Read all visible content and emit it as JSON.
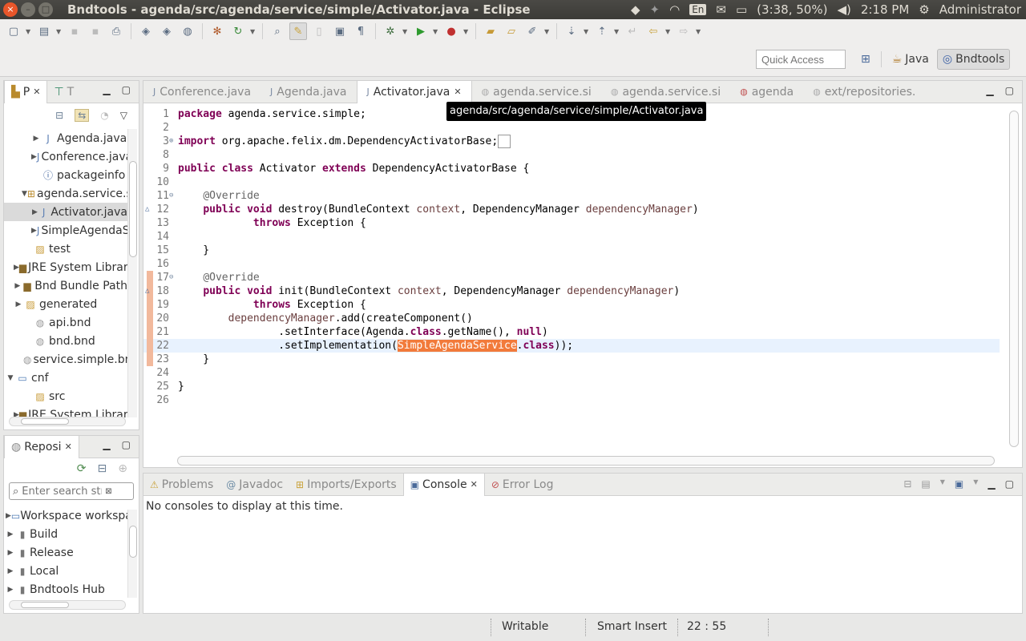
{
  "window": {
    "title": "Bndtools - agenda/src/agenda/service/simple/Activator.java - Eclipse",
    "buttons": {
      "close": "×",
      "minimize": "–",
      "maximize": "□"
    }
  },
  "tray": {
    "lang": "En",
    "battery": "(3:38, 50%)",
    "time": "2:18 PM",
    "user": "Administrator"
  },
  "toolbar": {
    "quick_access_placeholder": "Quick Access",
    "perspectives": [
      {
        "label": "Java"
      },
      {
        "label": "Bndtools"
      }
    ]
  },
  "project_explorer": {
    "tabs": [
      {
        "label": "P"
      },
      {
        "label": "T"
      }
    ],
    "items": [
      {
        "label": "Agenda.java",
        "indent": 1,
        "arrow": "▶",
        "icon": "java"
      },
      {
        "label": "Conference.java",
        "indent": 1,
        "arrow": "▶",
        "icon": "java"
      },
      {
        "label": "packageinfo",
        "indent": 1,
        "arrow": "",
        "icon": "info"
      },
      {
        "label": "agenda.service.simple",
        "indent": 0,
        "arrow": "▼",
        "icon": "pkg"
      },
      {
        "label": "Activator.java",
        "indent": 1,
        "arrow": "▶",
        "icon": "java",
        "selected": true
      },
      {
        "label": "SimpleAgendaService.java",
        "indent": 1,
        "arrow": "▶",
        "icon": "java"
      },
      {
        "label": "test",
        "indent": -1,
        "arrow": "",
        "icon": "folder"
      },
      {
        "label": "JRE System Library",
        "indent": -2,
        "arrow": "▶",
        "icon": "lib"
      },
      {
        "label": "Bnd Bundle Path",
        "indent": -2,
        "arrow": "▶",
        "icon": "lib"
      },
      {
        "label": "generated",
        "indent": -2,
        "arrow": "▶",
        "icon": "folder"
      },
      {
        "label": "api.bnd",
        "indent": -1,
        "arrow": "",
        "icon": "bnd"
      },
      {
        "label": "bnd.bnd",
        "indent": -1,
        "arrow": "",
        "icon": "bnd"
      },
      {
        "label": "service.simple.bnd",
        "indent": -1,
        "arrow": "",
        "icon": "bnd"
      },
      {
        "label": "cnf",
        "indent": -3,
        "arrow": "▼",
        "icon": "proj"
      },
      {
        "label": "src",
        "indent": -1,
        "arrow": "",
        "icon": "folder"
      },
      {
        "label": "JRE System Library",
        "indent": -2,
        "arrow": "▶",
        "icon": "lib"
      }
    ]
  },
  "repositories": {
    "tab_label": "Reposi",
    "search_placeholder": "Enter search string",
    "items": [
      {
        "label": "Workspace workspace"
      },
      {
        "label": "Build"
      },
      {
        "label": "Release"
      },
      {
        "label": "Local"
      },
      {
        "label": "Bndtools Hub"
      }
    ]
  },
  "editor": {
    "tabs": [
      {
        "label": "Conference.java",
        "active": false
      },
      {
        "label": "Agenda.java",
        "active": false
      },
      {
        "label": "Activator.java",
        "active": true
      },
      {
        "label": "agenda.service.si",
        "active": false
      },
      {
        "label": "agenda.service.si",
        "active": false
      },
      {
        "label": "agenda",
        "active": false
      },
      {
        "label": "ext/repositories.",
        "active": false
      }
    ],
    "tooltip": "agenda/src/agenda/service/simple/Activator.java",
    "lines": [
      {
        "n": "1",
        "html": "<span class=\"kw\">package</span> agenda.service.simple;"
      },
      {
        "n": "2",
        "html": ""
      },
      {
        "n": "3",
        "fold": "⊕",
        "html": "<span class=\"kw\">import</span> org.apache.felix.dm.DependencyActivatorBase;<span style=\"border:1px solid #999;padding:0 3px\"> </span>"
      },
      {
        "n": "8",
        "html": ""
      },
      {
        "n": "9",
        "html": "<span class=\"kw\">public class</span> Activator <span class=\"kw\">extends</span> DependencyActivatorBase {"
      },
      {
        "n": "10",
        "html": ""
      },
      {
        "n": "11",
        "fold": "⊖",
        "html": "    <span class=\"ann\">@Override</span>"
      },
      {
        "n": "12",
        "mark": "△",
        "html": "    <span class=\"kw\">public void</span> destroy(BundleContext <span class=\"param\">context</span>, DependencyManager <span class=\"param\">dependencyManager</span>)"
      },
      {
        "n": "13",
        "html": "            <span class=\"kw\">throws</span> Exception {"
      },
      {
        "n": "14",
        "html": ""
      },
      {
        "n": "15",
        "html": "    }"
      },
      {
        "n": "16",
        "html": ""
      },
      {
        "n": "17",
        "fold": "⊖",
        "marker": true,
        "html": "    <span class=\"ann\">@Override</span>"
      },
      {
        "n": "18",
        "mark": "△",
        "marker": true,
        "html": "    <span class=\"kw\">public void</span> init(BundleContext <span class=\"param\">context</span>, DependencyManager <span class=\"param\">dependencyManager</span>)"
      },
      {
        "n": "19",
        "marker": true,
        "html": "            <span class=\"kw\">throws</span> Exception {"
      },
      {
        "n": "20",
        "marker": true,
        "html": "        <span class=\"param\">dependencyManager</span>.add(createComponent()"
      },
      {
        "n": "21",
        "marker": true,
        "html": "                .setInterface(Agenda.<span class=\"kw\">class</span>.getName(), <span class=\"kw\">null</span>)"
      },
      {
        "n": "22",
        "marker": true,
        "cur": true,
        "html": "                .setImplementation(<span class=\"hl\">SimpleAgendaService</span>.<span class=\"kw\">class</span>));"
      },
      {
        "n": "23",
        "marker": true,
        "html": "    }"
      },
      {
        "n": "24",
        "html": ""
      },
      {
        "n": "25",
        "html": "}"
      },
      {
        "n": "26",
        "html": ""
      }
    ]
  },
  "bottom": {
    "tabs": [
      {
        "label": "Problems",
        "icon": "⚠",
        "active": false
      },
      {
        "label": "Javadoc",
        "icon": "@",
        "active": false
      },
      {
        "label": "Imports/Exports",
        "icon": "⊞",
        "active": false
      },
      {
        "label": "Console",
        "icon": "▣",
        "active": true
      },
      {
        "label": "Error Log",
        "icon": "⊘",
        "active": false
      }
    ],
    "message": "No consoles to display at this time."
  },
  "status": {
    "writable": "Writable",
    "insert_mode": "Smart Insert",
    "position": "22 : 55"
  }
}
